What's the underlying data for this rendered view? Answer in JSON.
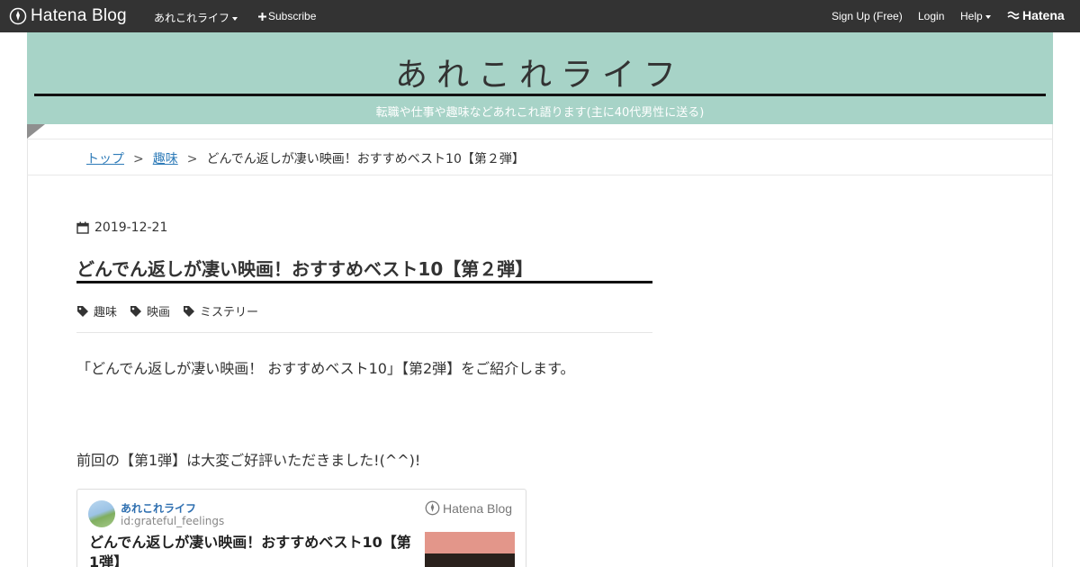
{
  "topbar": {
    "logo_text": "Hatena Blog",
    "blog_menu_label": "あれこれライフ",
    "subscribe_label": "Subscribe",
    "signup_label": "Sign Up (Free)",
    "login_label": "Login",
    "help_label": "Help",
    "hatena_label": "Hatena"
  },
  "header": {
    "title": "あれこれライフ",
    "description": "転職や仕事や趣味などあれこれ語ります(主に40代男性に送る)"
  },
  "breadcrumb": {
    "items": [
      "トップ",
      "趣味"
    ],
    "separator": ">",
    "current": "どんでん返しが凄い映画！おすすめベスト10【第２弾】"
  },
  "article": {
    "date": "2019-12-21",
    "title": "どんでん返しが凄い映画！おすすめベスト10【第２弾】",
    "categories": [
      "趣味",
      "映画",
      "ミステリー"
    ],
    "paragraph1": "「どんでん返しが凄い映画！ おすすめベスト10」【第2弾】をご紹介します。",
    "paragraph2": "前回の【第1弾】は大変ご好評いただきました!(^^)!"
  },
  "embed_card": {
    "author": "あれこれライフ",
    "user_id": "id:grateful_feelings",
    "service_logo": "Hatena Blog",
    "title": "どんでん返しが凄い映画！おすすめベスト10【第1弾】"
  },
  "colors": {
    "topbar_bg": "#333333",
    "header_bg": "#a7d3c7",
    "link": "#2e7bb8"
  }
}
